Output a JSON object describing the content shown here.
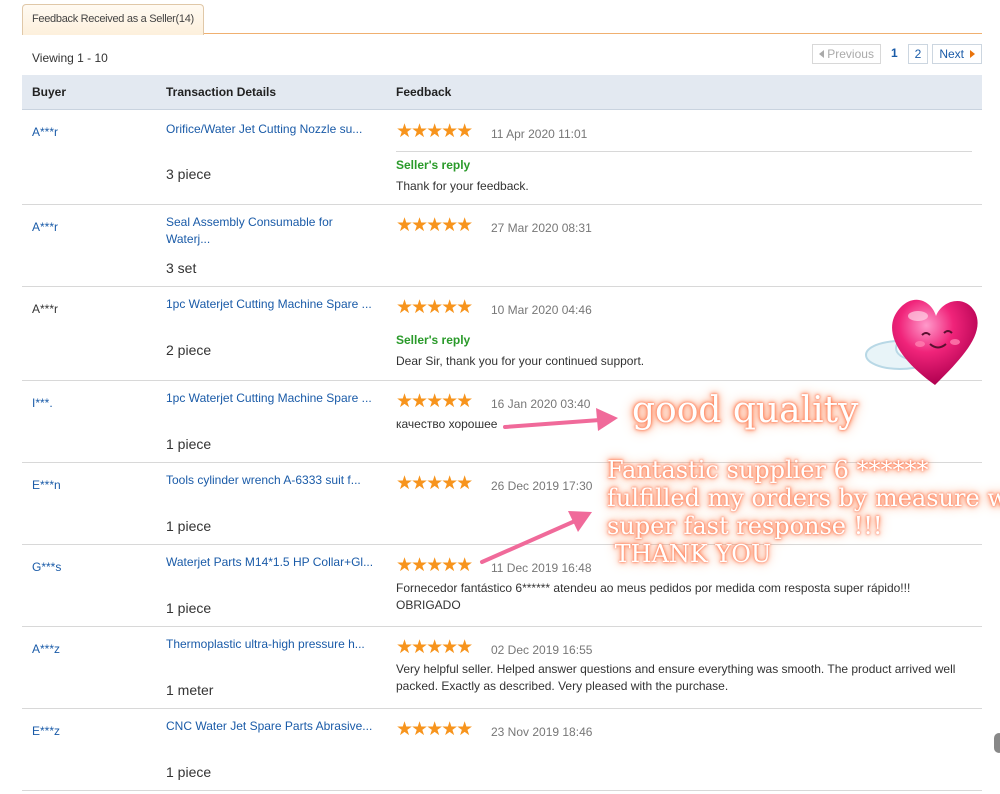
{
  "tab": {
    "label": "Feedback Received as a Seller(14)"
  },
  "viewing": "Viewing 1 - 10",
  "pagination": {
    "previous": "Previous",
    "pages": [
      "1",
      "2"
    ],
    "next": "Next"
  },
  "columns": {
    "buyer": "Buyer",
    "transaction": "Transaction Details",
    "feedback": "Feedback"
  },
  "rows": [
    {
      "buyer": "A***r",
      "product": "Orifice/Water Jet Cutting Nozzle su...",
      "qty": "3 piece",
      "stars": "★★★★★",
      "date": "11 Apr 2020 11:01",
      "reply_title": "Seller's reply",
      "reply_text": "Thank for your feedback."
    },
    {
      "buyer": "A***r",
      "product": "Seal Assembly Consumable for Waterj...",
      "qty": "3 set",
      "stars": "★★★★★",
      "date": "27 Mar 2020 08:31"
    },
    {
      "buyer": "A***r",
      "product": "1pc Waterjet Cutting Machine Spare ...",
      "qty": "2 piece",
      "stars": "★★★★★",
      "date": "10 Mar 2020 04:46",
      "reply_title": "Seller's reply",
      "reply_text": "Dear Sir, thank you for your continued support."
    },
    {
      "buyer": "I***.",
      "product": "1pc Waterjet Cutting Machine Spare ...",
      "qty": "1 piece",
      "stars": "★★★★★",
      "date": "16 Jan 2020 03:40",
      "comment": "качество хорошее"
    },
    {
      "buyer": "E***n",
      "product": "Tools cylinder wrench A-6333 suit f...",
      "qty": "1 piece",
      "stars": "★★★★★",
      "date": "26 Dec 2019 17:30"
    },
    {
      "buyer": "G***s",
      "product": "Waterjet Parts M14*1.5 HP Collar+Gl...",
      "qty": "1 piece",
      "stars": "★★★★★",
      "date": "11 Dec 2019 16:48",
      "comment": "Fornecedor fantástico 6****** atendeu ao meus pedidos por medida com resposta super rápido!!! OBRIGADO"
    },
    {
      "buyer": "A***z",
      "product": "Thermoplastic ultra-high pressure h...",
      "qty": "1 meter",
      "stars": "★★★★★",
      "date": "02 Dec 2019 16:55",
      "comment": "Very helpful seller. Helped answer questions and ensure everything was smooth. The product arrived well packed. Exactly as described. Very pleased with the purchase."
    },
    {
      "buyer": "E***z",
      "product": "CNC Water Jet Spare Parts Abrasive...",
      "qty": "1 piece",
      "stars": "★★★★★",
      "date": "23 Nov 2019 18:46"
    }
  ],
  "annotations": {
    "good_quality": "good quality",
    "fantastic": [
      "Fantastic supplier 6 ******",
      "fulfilled my orders by measure with",
      "super fast response !!!",
      " THANK YOU"
    ]
  },
  "colors": {
    "link": "#1a5ba8",
    "star": "#f7941d",
    "reply": "#2a9a2a",
    "header_bg": "#e3e9f1",
    "accent": "#e9730a"
  }
}
